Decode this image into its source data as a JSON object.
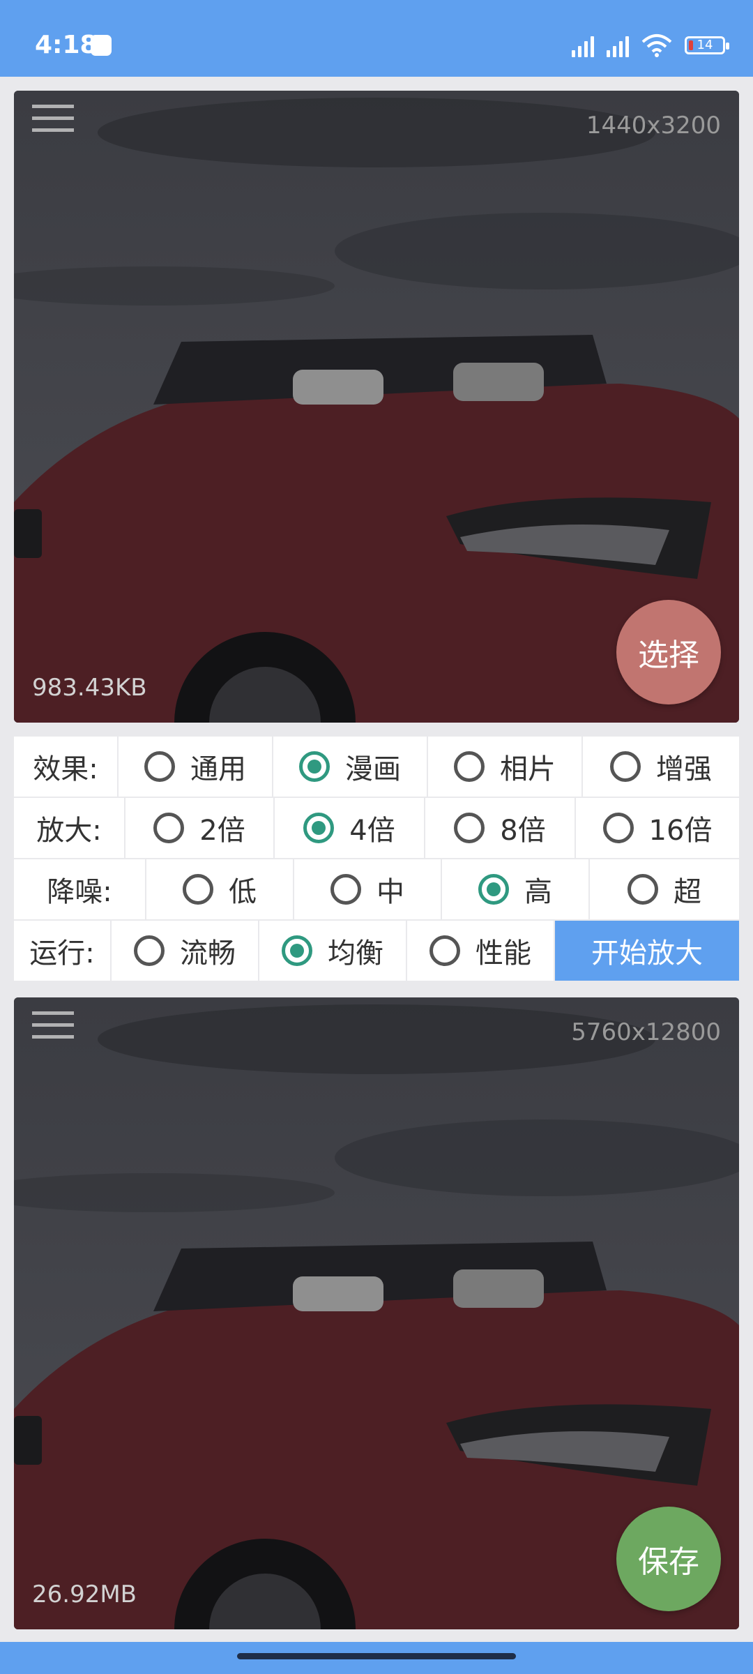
{
  "status": {
    "time": "4:18",
    "battery": "14"
  },
  "input_image": {
    "dimensions": "1440x3200",
    "file_size": "983.43KB",
    "action_label": "选择"
  },
  "output_image": {
    "dimensions": "5760x12800",
    "file_size": "26.92MB",
    "action_label": "保存"
  },
  "options": {
    "effect": {
      "label": "效果:",
      "choices": [
        "通用",
        "漫画",
        "相片",
        "增强"
      ],
      "selected": "漫画"
    },
    "scale": {
      "label": "放大:",
      "choices": [
        "2倍",
        "4倍",
        "8倍",
        "16倍"
      ],
      "selected": "4倍"
    },
    "denoise": {
      "label": "降噪:",
      "choices": [
        "低",
        "中",
        "高",
        "超"
      ],
      "selected": "高"
    },
    "run": {
      "label": "运行:",
      "choices": [
        "流畅",
        "均衡",
        "性能"
      ],
      "selected": "均衡",
      "start_label": "开始放大"
    }
  },
  "colors": {
    "accent": "#5fa0ef",
    "radio_checked": "#2f9980",
    "select_button": "#c17570",
    "save_button": "#6da860"
  },
  "icons": {
    "menu": "hamburger-menu-icon",
    "wifi": "wifi-icon",
    "signal": "signal-icon",
    "battery": "battery-icon"
  }
}
